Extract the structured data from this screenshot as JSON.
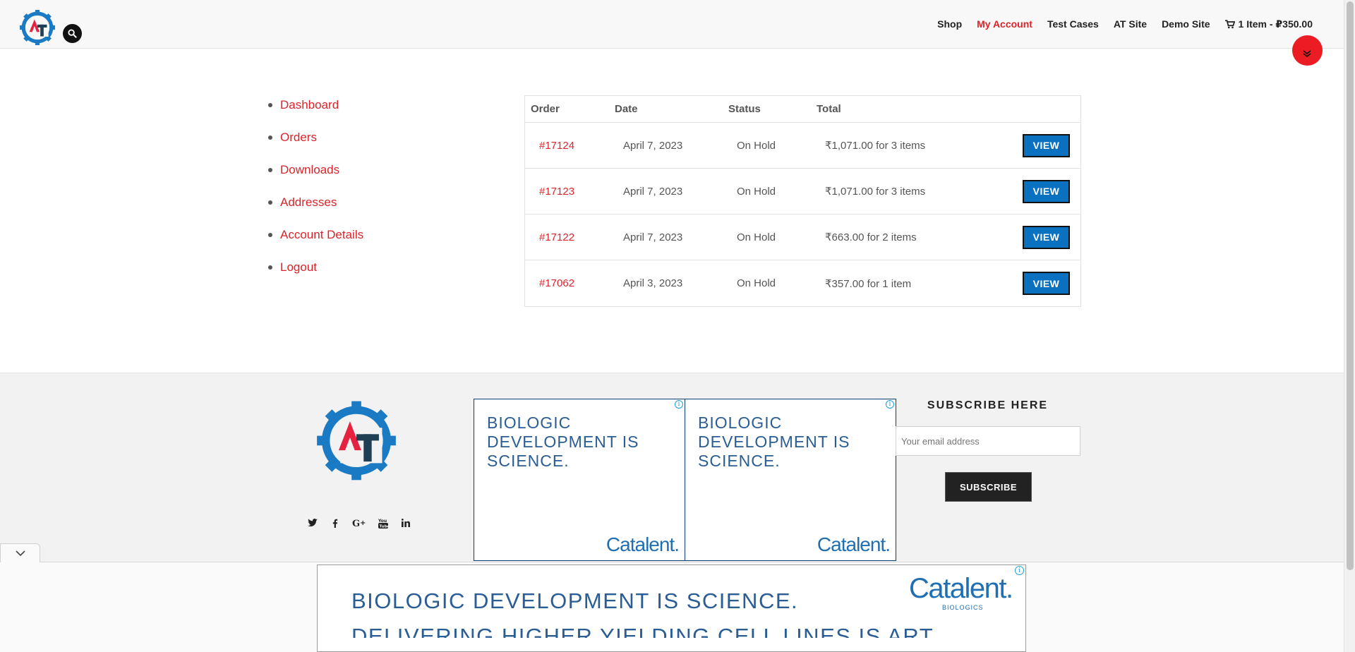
{
  "header": {
    "logo_icon": "gear-logo-icon",
    "search_icon": "search-icon",
    "nav": [
      {
        "label": "Shop"
      },
      {
        "label": "My Account",
        "active": true
      },
      {
        "label": "Test Cases"
      },
      {
        "label": "AT Site"
      },
      {
        "label": "Demo Site"
      }
    ],
    "cart": {
      "icon": "cart-icon",
      "label": "1 Item - ₽350.00"
    }
  },
  "account_nav": {
    "items": [
      {
        "label": "Dashboard"
      },
      {
        "label": "Orders"
      },
      {
        "label": "Downloads"
      },
      {
        "label": "Addresses"
      },
      {
        "label": "Account Details"
      },
      {
        "label": "Logout"
      }
    ]
  },
  "orders": {
    "columns": [
      "Order",
      "Date",
      "Status",
      "Total"
    ],
    "rows": [
      {
        "order": "#17124",
        "date": "April 7, 2023",
        "status": "On Hold",
        "total": "₹1,071.00 for 3 items",
        "action": "VIEW"
      },
      {
        "order": "#17123",
        "date": "April 7, 2023",
        "status": "On Hold",
        "total": "₹1,071.00 for 3 items",
        "action": "VIEW"
      },
      {
        "order": "#17122",
        "date": "April 7, 2023",
        "status": "On Hold",
        "total": "₹663.00 for 2 items",
        "action": "VIEW"
      },
      {
        "order": "#17062",
        "date": "April 3, 2023",
        "status": "On Hold",
        "total": "₹357.00 for 1 item",
        "action": "VIEW"
      }
    ]
  },
  "footer": {
    "social_icons": [
      "twitter-icon",
      "facebook-icon",
      "google-plus-icon",
      "youtube-icon",
      "linkedin-icon"
    ],
    "ads": [
      {
        "headline": "BIOLOGIC DEVELOPMENT IS SCIENCE.",
        "brand": "Catalent."
      },
      {
        "headline": "BIOLOGIC DEVELOPMENT IS SCIENCE.",
        "brand": "Catalent."
      }
    ],
    "subscribe": {
      "title": "SUBSCRIBE HERE",
      "placeholder": "Your email address",
      "button": "SUBSCRIBE"
    }
  },
  "bottom_ad": {
    "line1": "BIOLOGIC DEVELOPMENT IS SCIENCE.",
    "line2": "DELIVERING HIGHER YIELDING CELL LINES IS ART.",
    "brand": "Catalent.",
    "sub": "BIOLOGICS"
  },
  "colors": {
    "accent": "#d9252a",
    "button_blue": "#0a70c0",
    "logo_blue": "#1a7bc4",
    "logo_red": "#e5223f",
    "logo_dark": "#1f3f55"
  }
}
